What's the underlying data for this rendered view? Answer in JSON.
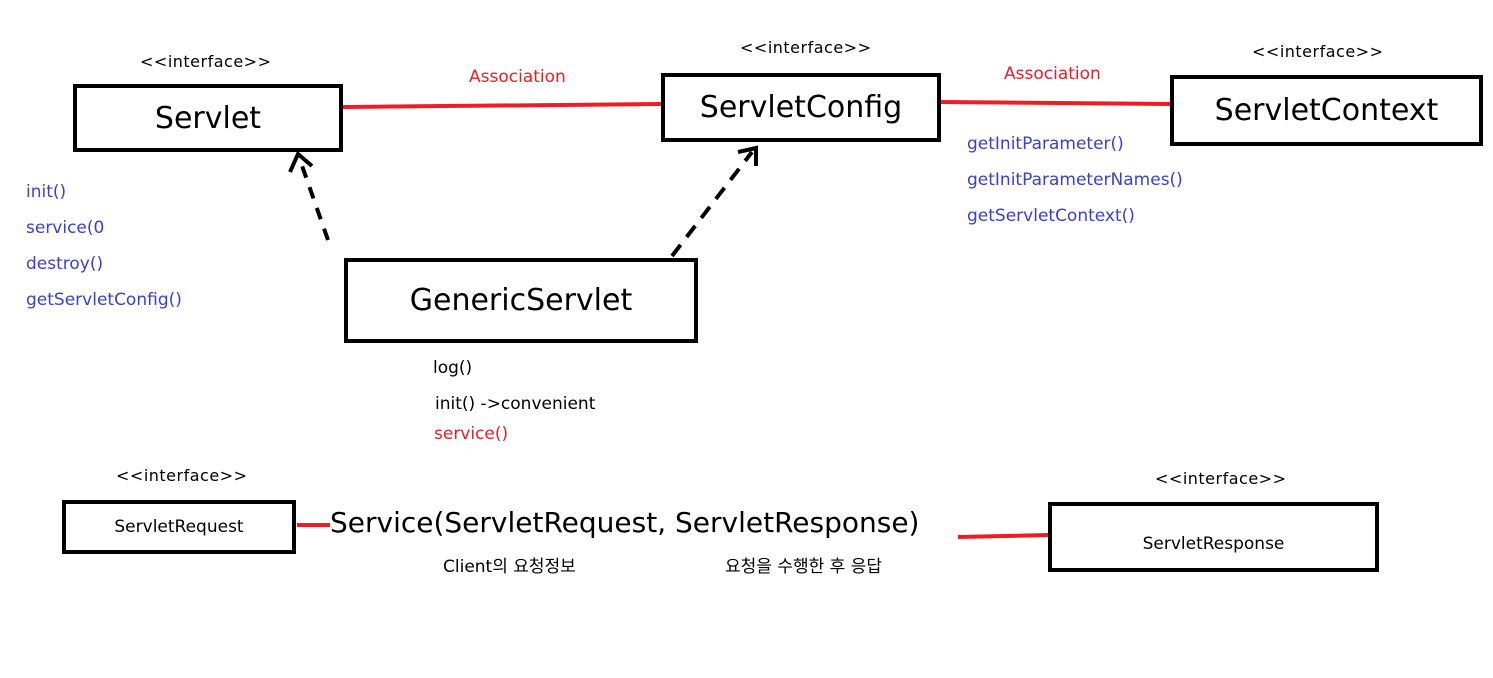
{
  "stereotype": "<<interface>>",
  "classes": {
    "servlet": {
      "name": "Servlet",
      "methods": [
        "init()",
        "service(0",
        "destroy()",
        "getServletConfig()"
      ]
    },
    "servlet_config": {
      "name": "ServletConfig"
    },
    "servlet_context": {
      "name": "ServletContext"
    },
    "servlet_config_methods": [
      "getInitParameter()",
      "getInitParameterNames()",
      "getServletContext()"
    ],
    "generic_servlet": {
      "name": "GenericServlet",
      "methods": [
        "log()",
        "init() ->convenient",
        "service()"
      ]
    },
    "servlet_request": {
      "name": "ServletRequest"
    },
    "servlet_response": {
      "name": "ServletResponse"
    }
  },
  "relations": {
    "association_1": "Association",
    "association_2": "Association"
  },
  "service_signature": "Service(ServletRequest, ServletResponse)",
  "request_note": "Client의 요청정보",
  "response_note": "요청을 수행한 후 응답",
  "colors": {
    "association": "#ee1c24",
    "methods": "#3a3fd0",
    "highlight": "#ee1c24",
    "border": "#000000"
  }
}
